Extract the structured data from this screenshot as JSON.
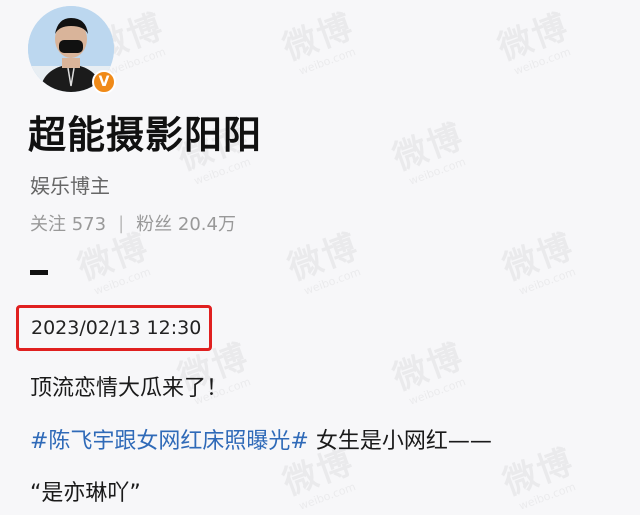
{
  "profile": {
    "name": "超能摄影阳阳",
    "role": "娱乐博主",
    "following_label": "关注",
    "following_count": "573",
    "followers_label": "粉丝",
    "followers_count": "20.4万",
    "separator": "|"
  },
  "post": {
    "dash": "一",
    "timestamp": "2023/02/13 12:30",
    "line1": "顶流恋情大瓜来了！",
    "hashtag": "#陈飞宇跟女网红床照曝光#",
    "line2_rest": " 女生是小网红——",
    "line3": "“是亦琳吖”"
  },
  "watermark": {
    "text_cn": "微博",
    "text_en": "weibo.com"
  },
  "colors": {
    "highlight_box": "#e02020",
    "hashtag": "#2f6ab8",
    "verified_badge": "#f08a18"
  },
  "icons": {
    "verified": "verified-v-icon"
  }
}
